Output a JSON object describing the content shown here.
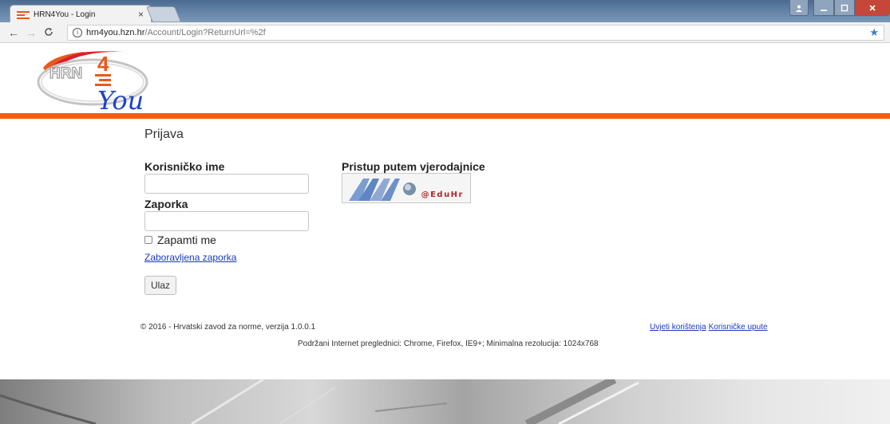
{
  "browser": {
    "tab_title": "HRN4You - Login",
    "tab_close": "×",
    "url_host": "hrn4you.hzn.hr",
    "url_path": "/Account/Login?ReturnUrl=%2f"
  },
  "logo": {
    "text_hrn": "HRN",
    "text_4": "4",
    "text_you": "You"
  },
  "login": {
    "title": "Prijava",
    "username_label": "Korisničko ime",
    "username_value": "",
    "password_label": "Zaporka",
    "password_value": "",
    "remember_label": "Zapamti me",
    "forgot_link": "Zaboravljena zaporka",
    "submit_label": "Ulaz"
  },
  "federated": {
    "title": "Pristup putem vjerodajnice",
    "aai_text": "@EduHr"
  },
  "footer": {
    "copyright": "© 2016 - Hrvatski zavod za norme, verzija 1.0.0.1",
    "terms_link": "Uvjeti korištenja",
    "manual_link": "Korisničke upute",
    "browsers_note": "Podržani Internet preglednici: Chrome, Firefox, IE9+; Minimalna rezolucija: 1024x768"
  },
  "colors": {
    "accent_orange": "#f45d0d",
    "link_blue": "#1a37c9",
    "logo_blue": "#1b43c8",
    "logo_red": "#d8202a"
  }
}
